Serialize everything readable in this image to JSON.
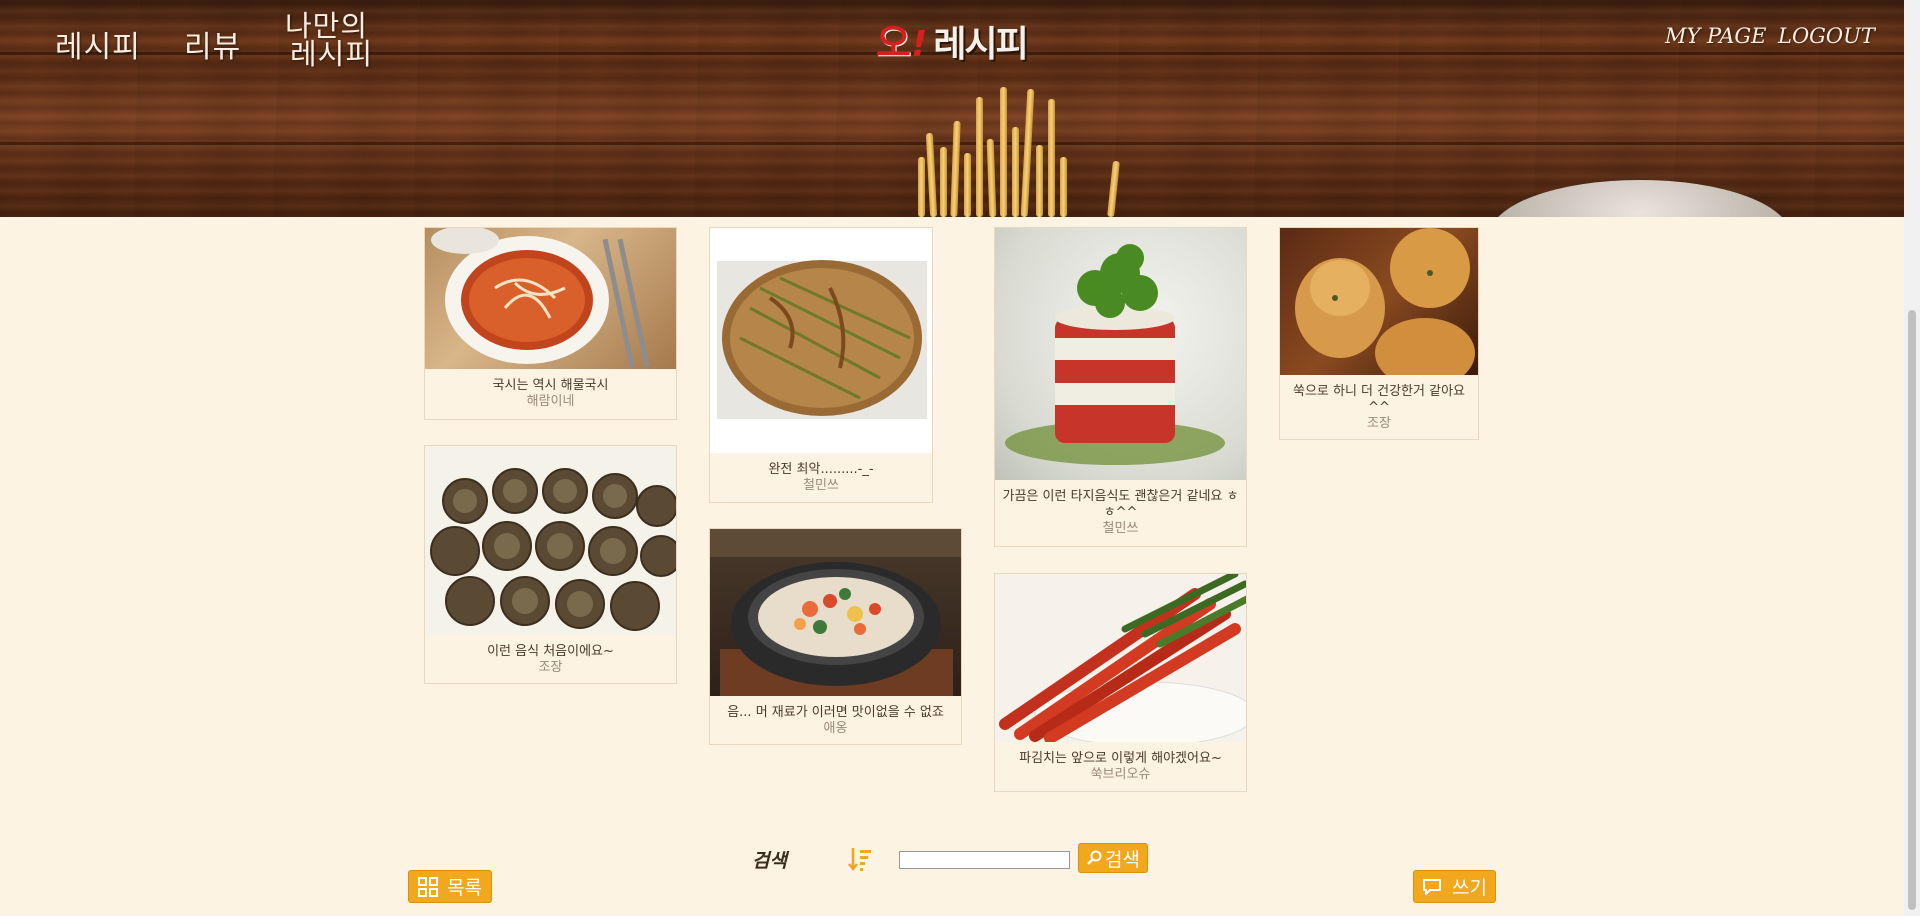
{
  "nav": {
    "recipe": "레시피",
    "review": "리뷰",
    "my_recipe_line1": "나만의",
    "my_recipe_line2": "레시피"
  },
  "logo": {
    "o": "오",
    "ex": "!",
    "text": "레시피"
  },
  "topright": {
    "mypage": "MY PAGE",
    "logout": "LOGOUT"
  },
  "posts": [
    {
      "title": "국시는 역시 해물국시",
      "author": "해람이네"
    },
    {
      "title": "이런 음식 처음이에요~",
      "author": "조장"
    },
    {
      "title": "완전 최악.........-_-",
      "author": "철민쓰"
    },
    {
      "title": "음... 머 재료가 이러면 맛이없을 수 없죠",
      "author": "애옹"
    },
    {
      "title": "가끔은 이런 타지음식도 괜찮은거 같네요 ㅎㅎ^^",
      "author": "철민쓰"
    },
    {
      "title": "파김치는 앞으로 이렇게 해야겠어요~",
      "author": "쑥브리오슈"
    },
    {
      "title": "쑥으로 하니 더 건강한거 같아요 ^^",
      "author": "조장"
    }
  ],
  "search": {
    "label": "검색",
    "input_value": "",
    "button_label": "검색"
  },
  "buttons": {
    "list": "목록",
    "write": "쓰기"
  },
  "colors": {
    "accent": "#f2a81d",
    "background": "#fdf3e2",
    "logo_red": "#d61f1f"
  },
  "icons": [
    "sort-icon",
    "search-icon",
    "grid-icon",
    "comment-icon"
  ]
}
